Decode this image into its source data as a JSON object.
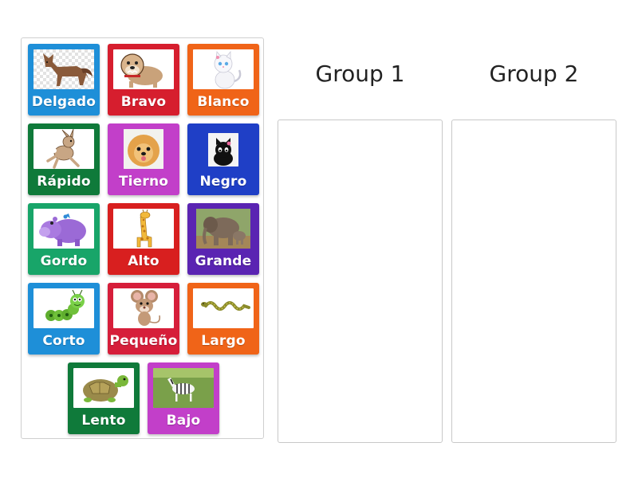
{
  "cards": [
    {
      "label": "Delgado",
      "color": "#1e8fd8",
      "icon": "fox-image"
    },
    {
      "label": "Bravo",
      "color": "#d61e2e",
      "icon": "bulldog-image"
    },
    {
      "label": "Blanco",
      "color": "#f06418",
      "icon": "white-cat-image"
    },
    {
      "label": "Rápido",
      "color": "#0f7a3a",
      "icon": "rabbit-image"
    },
    {
      "label": "Tierno",
      "color": "#c23fc9",
      "icon": "pomeranian-image"
    },
    {
      "label": "Negro",
      "color": "#1f3fc6",
      "icon": "black-cat-image"
    },
    {
      "label": "Gordo",
      "color": "#18a569",
      "icon": "hippo-image"
    },
    {
      "label": "Alto",
      "color": "#d81f1f",
      "icon": "giraffe-image"
    },
    {
      "label": "Grande",
      "color": "#5a24b2",
      "icon": "elephant-image"
    },
    {
      "label": "Corto",
      "color": "#1e8fd8",
      "icon": "caterpillar-image"
    },
    {
      "label": "Pequeño",
      "color": "#d61e3a",
      "icon": "mouse-image"
    },
    {
      "label": "Largo",
      "color": "#f06418",
      "icon": "snake-image"
    },
    {
      "label": "Lento",
      "color": "#0f7a3a",
      "icon": "turtle-image"
    },
    {
      "label": "Bajo",
      "color": "#c23fc9",
      "icon": "zebra-image"
    }
  ],
  "groups": [
    {
      "title": "Group 1"
    },
    {
      "title": "Group 2"
    }
  ]
}
